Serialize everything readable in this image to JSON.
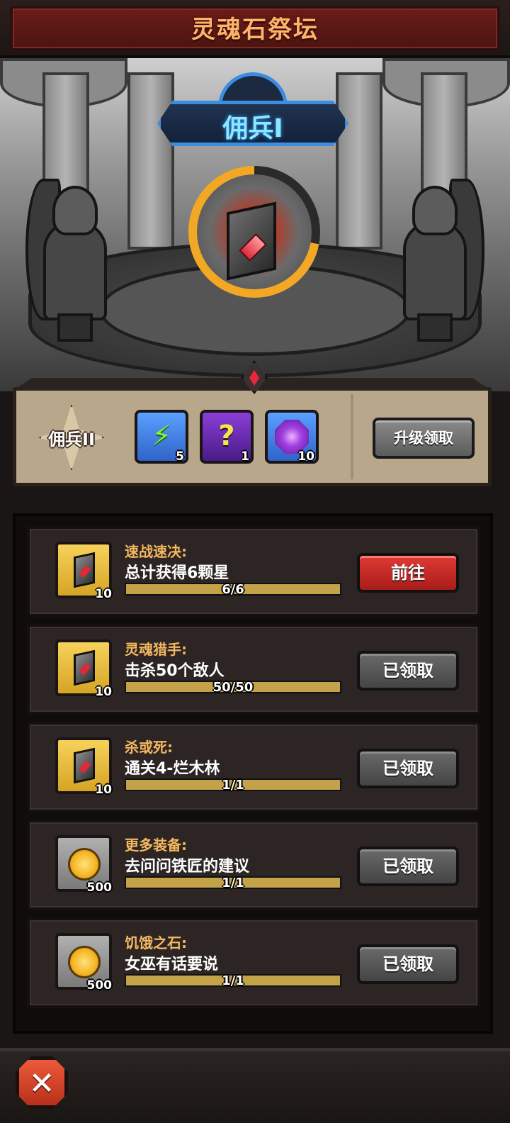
{
  "header": {
    "title": "灵魂石祭坛"
  },
  "altar": {
    "current_rank": "佣兵I",
    "progress": 0.72
  },
  "rank_reward": {
    "next_rank": "佣兵II",
    "items": [
      {
        "icon": "energy-bolt-icon",
        "qty": "5"
      },
      {
        "icon": "mystery-box-icon",
        "qty": "1"
      },
      {
        "icon": "purple-portal-stone-icon",
        "qty": "10"
      }
    ],
    "upgrade_label": "升级领取"
  },
  "quests": [
    {
      "title": "速战速决:",
      "desc": "总计获得6颗星",
      "progress_text": "6/6",
      "progress": 1.0,
      "reward_icon": "soul-stone-icon",
      "reward_qty": "10",
      "button": "前往",
      "button_state": "go"
    },
    {
      "title": "灵魂猎手:",
      "desc": "击杀50个敌人",
      "progress_text": "50/50",
      "progress": 1.0,
      "reward_icon": "soul-stone-icon",
      "reward_qty": "10",
      "button": "已领取",
      "button_state": "done"
    },
    {
      "title": "杀或死:",
      "desc": "通关4-烂木林",
      "progress_text": "1/1",
      "progress": 1.0,
      "reward_icon": "soul-stone-icon",
      "reward_qty": "10",
      "button": "已领取",
      "button_state": "done"
    },
    {
      "title": "更多装备:",
      "desc": "去问问铁匠的建议",
      "progress_text": "1/1",
      "progress": 1.0,
      "reward_icon": "gold-coin-icon",
      "reward_qty": "500",
      "button": "已领取",
      "button_state": "done"
    },
    {
      "title": "饥饿之石:",
      "desc": "女巫有话要说",
      "progress_text": "1/1",
      "progress": 1.0,
      "reward_icon": "gold-coin-icon",
      "reward_qty": "500",
      "button": "已领取",
      "button_state": "done"
    }
  ],
  "footer": {
    "close_icon": "close-x-icon"
  }
}
